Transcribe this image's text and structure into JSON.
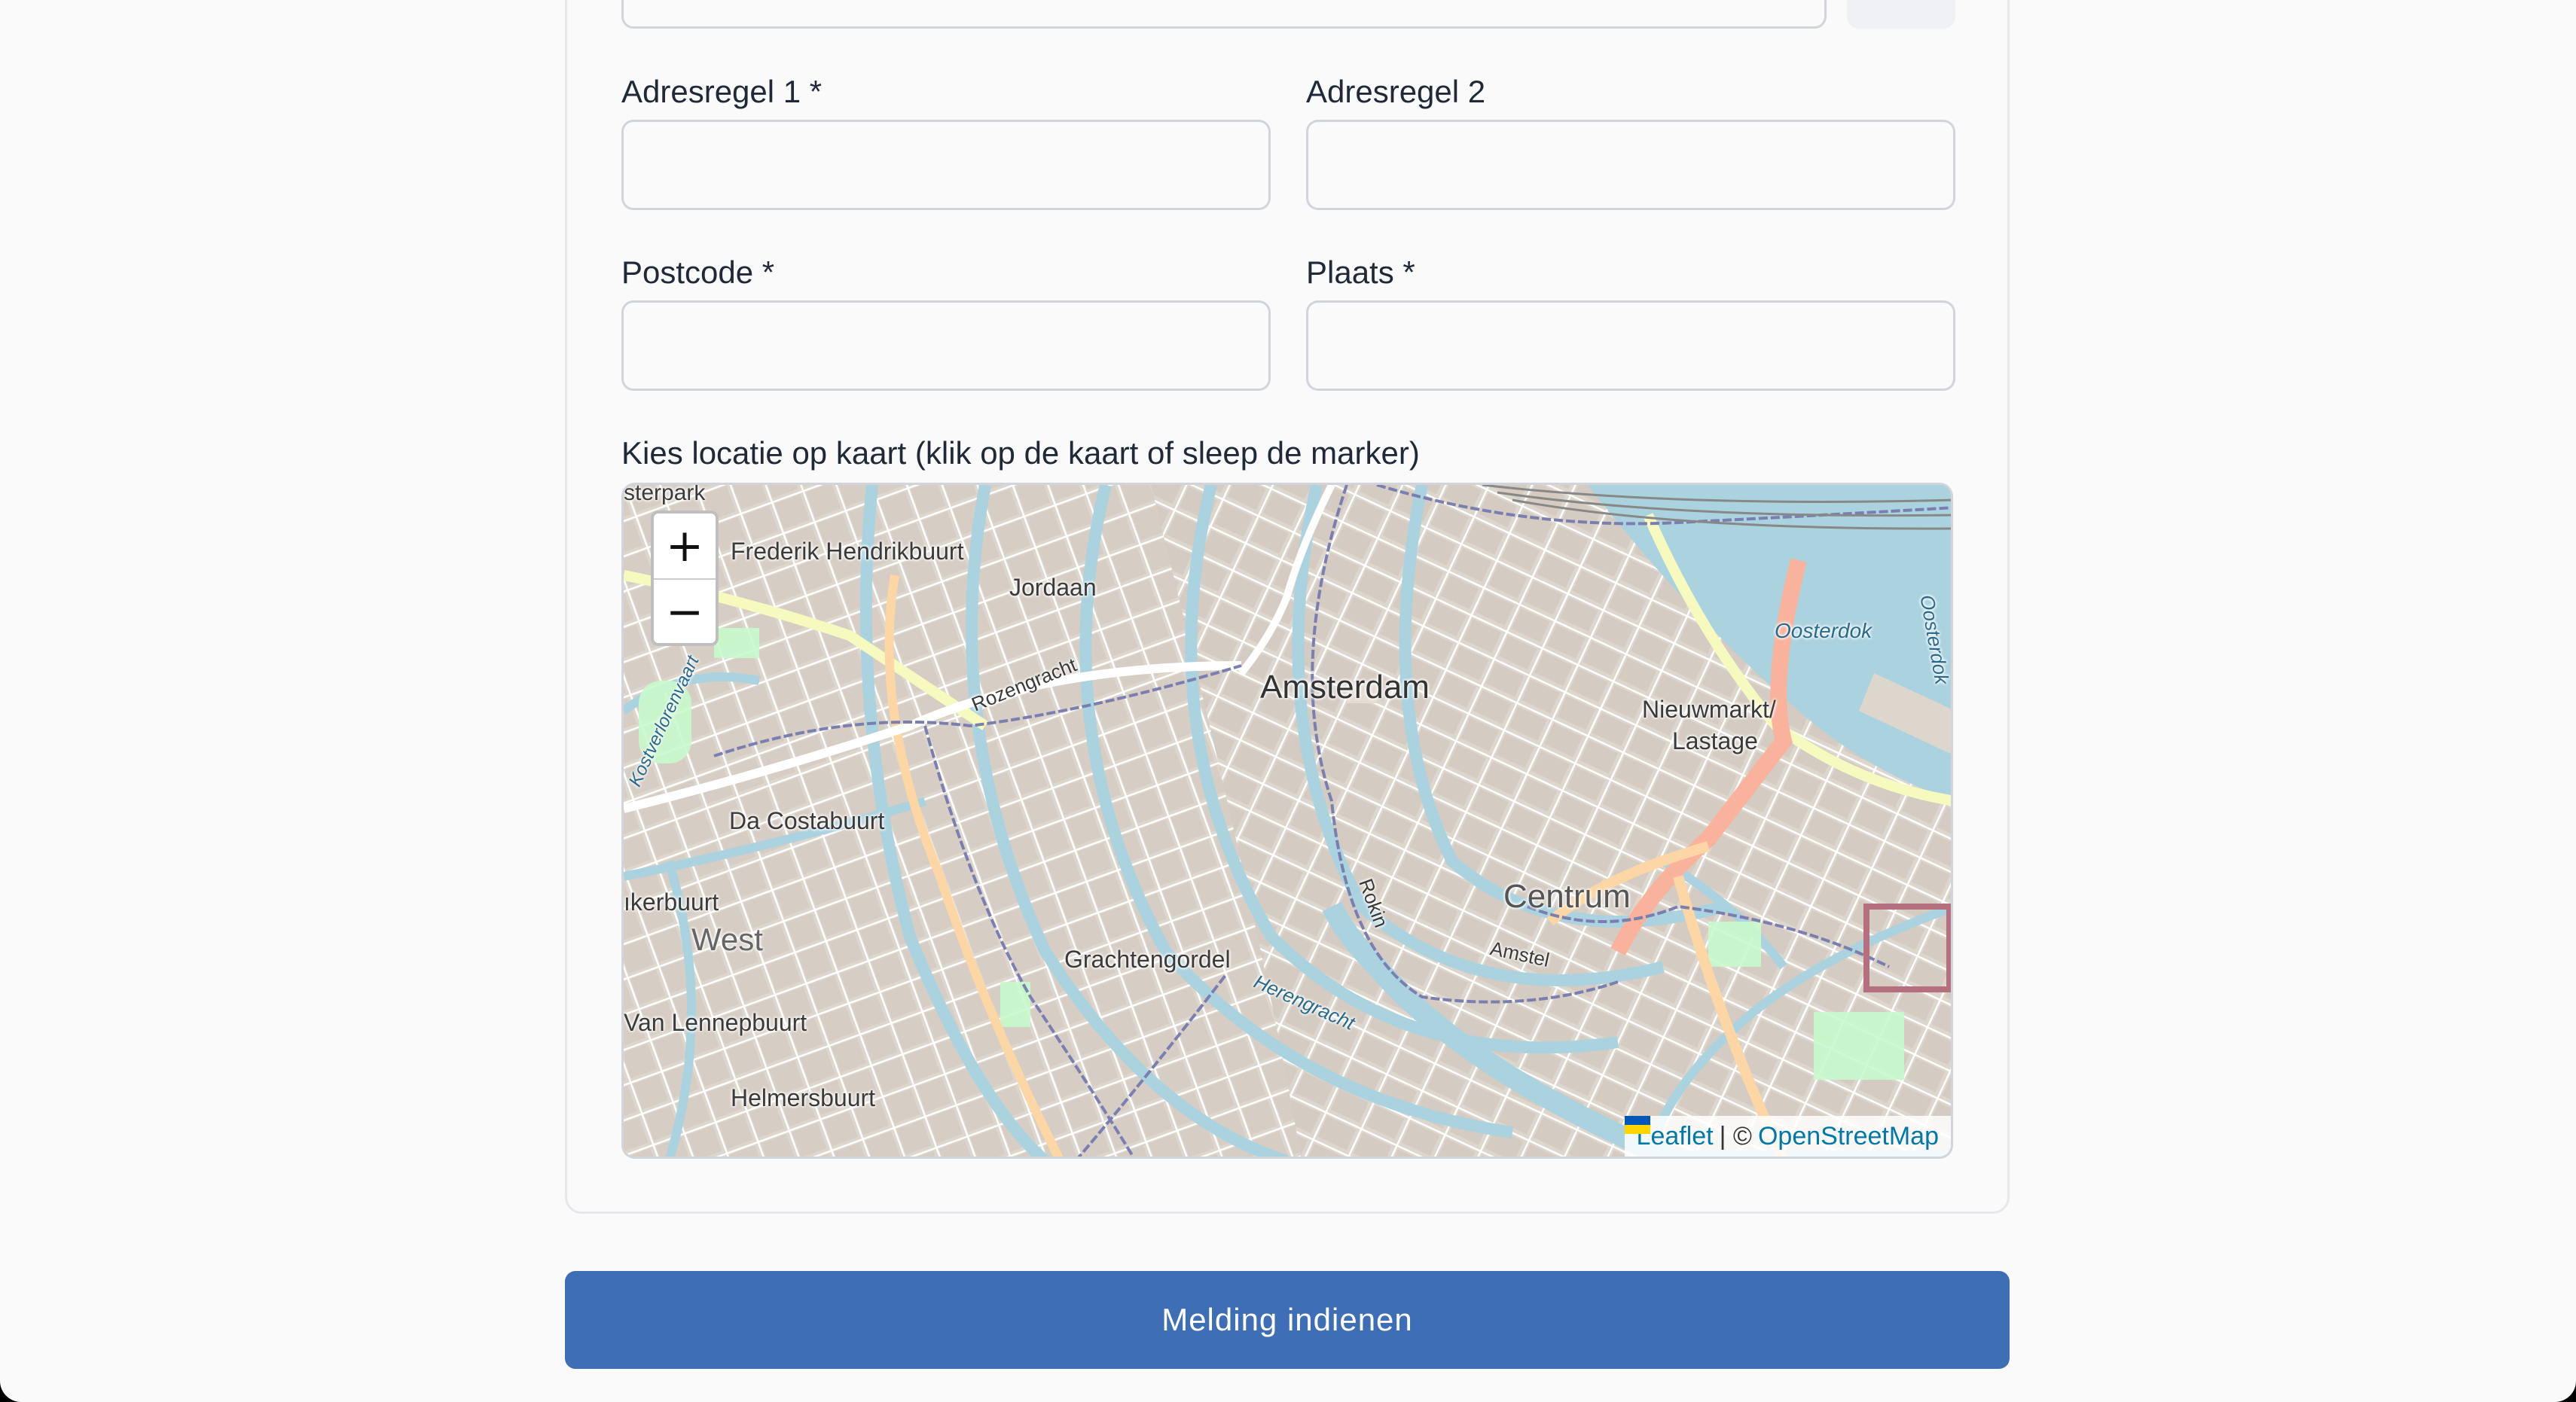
{
  "form": {
    "address_line_1_label": "Adresregel 1 *",
    "address_line_2_label": "Adresregel 2",
    "postcode_label": "Postcode *",
    "city_label": "Plaats *",
    "address_line_1_value": "",
    "address_line_2_value": "",
    "postcode_value": "",
    "city_value": "",
    "map_label": "Kies locatie op kaart (klik op de kaart of sleep de marker)",
    "submit_label": "Melding indienen"
  },
  "map": {
    "zoom_in": "+",
    "zoom_out": "−",
    "attribution_leaflet": "Leaflet",
    "attribution_sep": "| ©",
    "attribution_osm": "OpenStreetMap",
    "labels": {
      "amsterdam": "Amsterdam",
      "centrum": "Centrum",
      "west": "West",
      "frederik": "Frederik Hendrikbuurt",
      "jordaan": "Jordaan",
      "rozengracht": "Rozengracht",
      "costabuurt": "Da Costabuurt",
      "kerbuurt": "ıkerbuurt",
      "lennep": "Van Lennepbuurt",
      "helmers": "Helmersbuurt",
      "grachtengordel": "Grachtengordel",
      "herengracht": "Herengracht",
      "rokin": "Rokin",
      "amstel": "Amstel",
      "nieuwmarkt": "Nieuwmarkt/",
      "lastage": "Lastage",
      "oosterdok": "Oosterdok",
      "oosterdok2": "Oosterdok",
      "kostverloren": "Kostverlorenvaart",
      "westerpark": "sterpark"
    },
    "colors": {
      "land": "#ddd6cd",
      "water": "#aad3df",
      "road": "#ffffff",
      "major_road": "#fcd6a4",
      "primary_road": "#f9b29c",
      "highway": "#f7fabf",
      "park": "#c8facc",
      "building": "#d9d0c9",
      "rail": "#7a7fb0"
    }
  }
}
